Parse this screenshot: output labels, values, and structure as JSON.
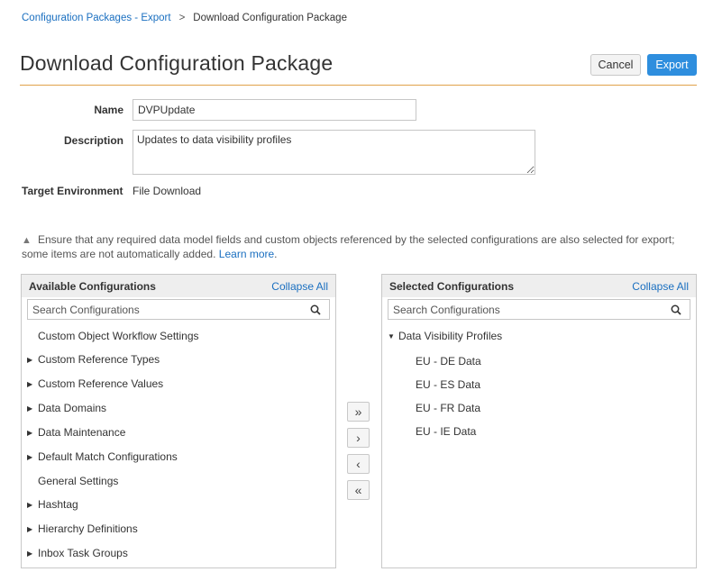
{
  "breadcrumb": {
    "parent": "Configuration Packages - Export",
    "separator": ">",
    "current": "Download Configuration Package"
  },
  "page": {
    "title": "Download Configuration Package"
  },
  "actions": {
    "cancel_label": "Cancel",
    "export_label": "Export"
  },
  "form": {
    "name_label": "Name",
    "name_value": "DVPUpdate",
    "description_label": "Description",
    "description_value": "Updates to data visibility profiles",
    "target_label": "Target Environment",
    "target_value": "File Download"
  },
  "warning": {
    "text": "Ensure that any required data model fields and custom objects referenced by the selected configurations are also selected for export; some items are not automatically added.",
    "link": "Learn more",
    "trailing": "."
  },
  "available": {
    "title": "Available Configurations",
    "collapse_label": "Collapse All",
    "search_placeholder": "Search Configurations",
    "items": [
      {
        "label": "Custom Object Workflow Settings",
        "expandable": false
      },
      {
        "label": "Custom Reference Types",
        "expandable": true
      },
      {
        "label": "Custom Reference Values",
        "expandable": true
      },
      {
        "label": "Data Domains",
        "expandable": true
      },
      {
        "label": "Data Maintenance",
        "expandable": true
      },
      {
        "label": "Default Match Configurations",
        "expandable": true
      },
      {
        "label": "General Settings",
        "expandable": false
      },
      {
        "label": "Hashtag",
        "expandable": true
      },
      {
        "label": "Hierarchy Definitions",
        "expandable": true
      },
      {
        "label": "Inbox Task Groups",
        "expandable": true
      }
    ]
  },
  "selected": {
    "title": "Selected Configurations",
    "collapse_label": "Collapse All",
    "search_placeholder": "Search Configurations",
    "group": "Data Visibility Profiles",
    "items": [
      "EU - DE Data",
      "EU - ES Data",
      "EU - FR Data",
      "EU - IE Data"
    ]
  },
  "transfer": {
    "add_all": "»",
    "add": "›",
    "remove": "‹",
    "remove_all": "«"
  },
  "colors": {
    "accent_blue": "#2e8ede",
    "link_blue": "#1a6fc0",
    "title_rule": "#e0a24a"
  }
}
